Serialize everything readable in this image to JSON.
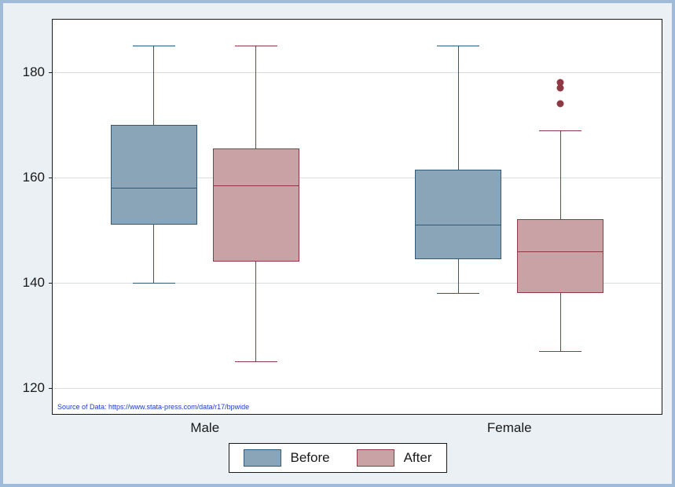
{
  "chart_data": {
    "type": "boxplot",
    "ylabel": "",
    "xlabel": "",
    "ylim": [
      115,
      190
    ],
    "y_ticks": [
      120,
      140,
      160,
      180
    ],
    "categories": [
      "Male",
      "Female"
    ],
    "series": [
      {
        "name": "Before",
        "color_fill": "#8aa4b8",
        "color_line": "#2f5a7a",
        "boxes": [
          {
            "category": "Male",
            "min": 140,
            "q1": 151,
            "median": 158,
            "q3": 170,
            "max": 185,
            "outliers": []
          },
          {
            "category": "Female",
            "min": 138,
            "q1": 144.5,
            "median": 151,
            "q3": 161.5,
            "max": 185,
            "outliers": []
          }
        ]
      },
      {
        "name": "After",
        "color_fill": "#c9a2a6",
        "color_line": "#8e3a45",
        "boxes": [
          {
            "category": "Male",
            "min": 125,
            "q1": 144,
            "median": 158.5,
            "q3": 165.5,
            "max": 185,
            "outliers": []
          },
          {
            "category": "Female",
            "min": 127,
            "q1": 138,
            "median": 146,
            "q3": 152,
            "max": 169,
            "outliers": [
              174,
              177,
              178
            ]
          }
        ]
      }
    ],
    "note": "Source of Data: https://www.stata-press.com/data/r17/bpwide"
  },
  "legend": {
    "items": [
      {
        "label": "Before"
      },
      {
        "label": "After"
      }
    ]
  },
  "x_axis_labels": {
    "0": "Male",
    "1": "Female"
  }
}
